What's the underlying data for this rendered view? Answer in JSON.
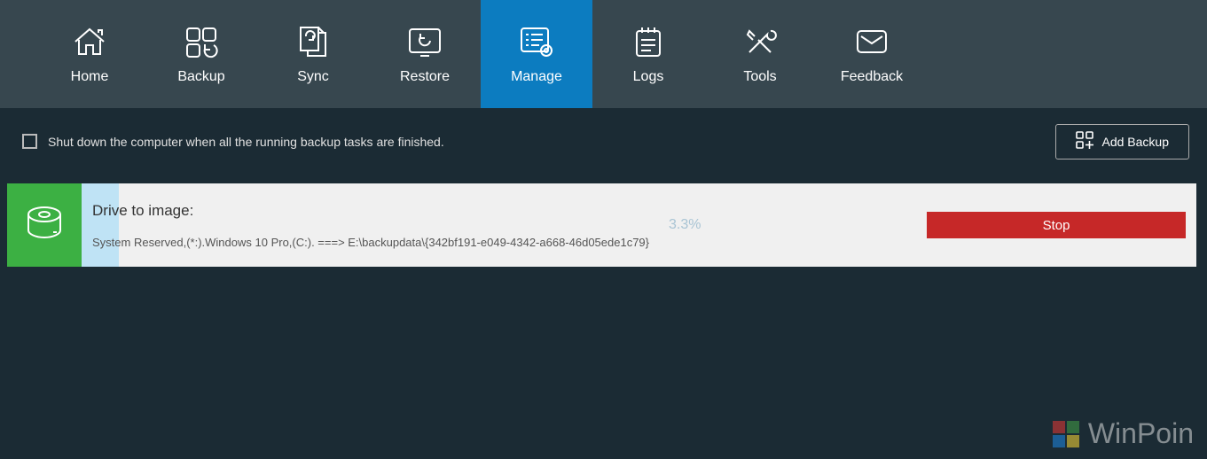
{
  "nav": {
    "items": [
      {
        "label": "Home",
        "icon": "home-icon",
        "active": false
      },
      {
        "label": "Backup",
        "icon": "backup-icon",
        "active": false
      },
      {
        "label": "Sync",
        "icon": "sync-icon",
        "active": false
      },
      {
        "label": "Restore",
        "icon": "restore-icon",
        "active": false
      },
      {
        "label": "Manage",
        "icon": "manage-icon",
        "active": true
      },
      {
        "label": "Logs",
        "icon": "logs-icon",
        "active": false
      },
      {
        "label": "Tools",
        "icon": "tools-icon",
        "active": false
      },
      {
        "label": "Feedback",
        "icon": "feedback-icon",
        "active": false
      }
    ]
  },
  "toolbar": {
    "shutdown_label": "Shut down the computer when all the running backup tasks are finished.",
    "shutdown_checked": false,
    "add_backup_label": "Add Backup"
  },
  "task": {
    "title": "Drive to image:",
    "detail": "System Reserved,(*:).Windows 10 Pro,(C:). ===> E:\\backupdata\\{342bf191-e049-4342-a668-46d05ede1c79}",
    "progress_percent": "3.3%",
    "stop_label": "Stop"
  },
  "watermark": {
    "text": "WinPoin",
    "colors": [
      "#e53935",
      "#43a047",
      "#1e88e5",
      "#fdd835"
    ]
  },
  "colors": {
    "nav_bg": "#37474f",
    "nav_active": "#0c7cc0",
    "body_bg": "#1b2b34",
    "task_icon_bg": "#3cb043",
    "task_progress_bg": "#bfe3f5",
    "task_body_bg": "#f0f0f0",
    "stop_btn": "#c62828"
  }
}
